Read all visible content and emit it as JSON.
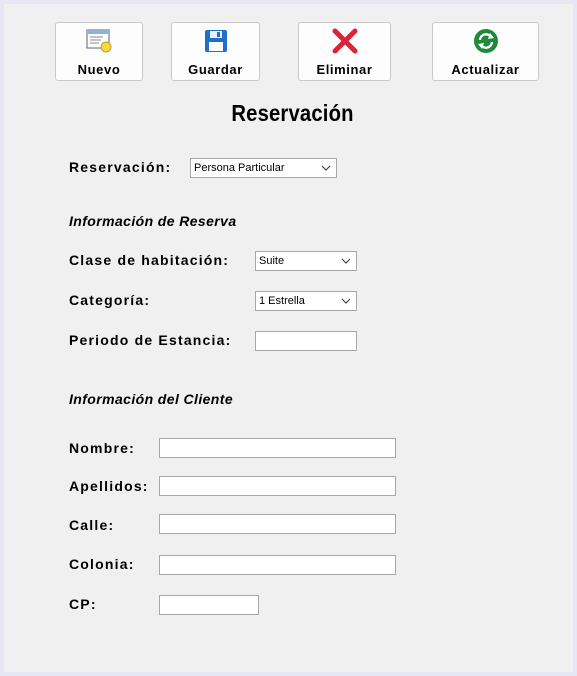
{
  "toolbar": {
    "nuevo_label": "Nuevo",
    "guardar_label": "Guardar",
    "eliminar_label": "Eliminar",
    "actualizar_label": "Actualizar"
  },
  "page_title": "Reservación",
  "reservacion": {
    "label": "Reservación:",
    "selected": "Persona Particular"
  },
  "reserva_section": {
    "heading": "Información de Reserva",
    "clase_label": "Clase de habitación:",
    "clase_value": "Suite",
    "categoria_label": "Categoría:",
    "categoria_value": "1 Estrella",
    "periodo_label": "Periodo de Estancia:",
    "periodo_value": ""
  },
  "cliente_section": {
    "heading": "Información del Cliente",
    "nombre_label": "Nombre:",
    "nombre_value": "",
    "apellidos_label": "Apellidos:",
    "apellidos_value": "",
    "calle_label": "Calle:",
    "calle_value": "",
    "colonia_label": "Colonia:",
    "colonia_value": "",
    "cp_label": "CP:",
    "cp_value": ""
  },
  "icons": {
    "new": "new-document-icon",
    "save": "floppy-disk-icon",
    "delete": "red-x-icon",
    "refresh": "refresh-icon"
  },
  "colors": {
    "background": "#f0f0f0",
    "frame_border": "#e6e6f5",
    "delete_red": "#d9253a",
    "refresh_green": "#1f8a3b",
    "save_blue": "#1e6fc8"
  }
}
